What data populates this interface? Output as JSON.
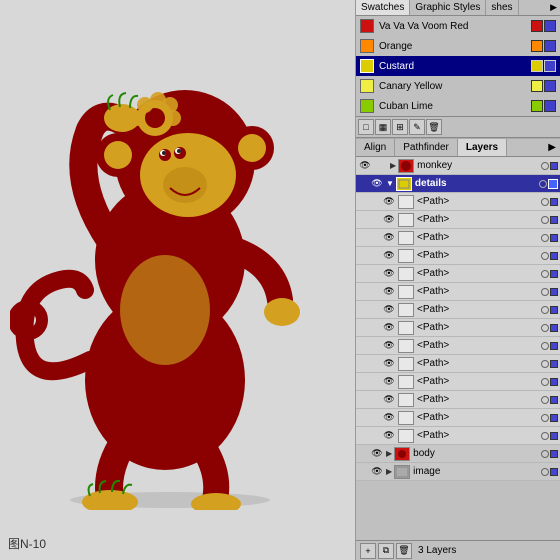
{
  "canvas": {
    "label": "图N-10",
    "background": "#d8d8d8"
  },
  "swatches": {
    "tabs": [
      {
        "id": "swatches",
        "label": "Swatches",
        "active": true
      },
      {
        "id": "graphic-styles",
        "label": "Graphic Styles",
        "active": false
      },
      {
        "id": "shes",
        "label": "shes",
        "active": false
      }
    ],
    "items": [
      {
        "name": "Va Va Va Voom Red",
        "color": "#cc1111",
        "selected": false
      },
      {
        "name": "Orange",
        "color": "#ff8800",
        "selected": false
      },
      {
        "name": "Custard",
        "color": "#ddcc00",
        "selected": true
      },
      {
        "name": "Canary Yellow",
        "color": "#eeee44",
        "selected": false
      },
      {
        "name": "Cuban Lime",
        "color": "#88cc00",
        "selected": false
      }
    ]
  },
  "panels": {
    "align_label": "Align",
    "pathfinder_label": "Pathfinder",
    "layers_label": "Layers",
    "active_tab": "Layers"
  },
  "layers": {
    "items": [
      {
        "id": "monkey",
        "name": "monkey",
        "type": "layer",
        "level": 0,
        "expanded": true,
        "thumb_color": "#cc1111"
      },
      {
        "id": "details",
        "name": "details",
        "type": "sublayer",
        "level": 1,
        "expanded": true,
        "active": true,
        "thumb_color": "#ddcc00"
      },
      {
        "id": "path1",
        "name": "<Path>",
        "type": "path",
        "level": 2
      },
      {
        "id": "path2",
        "name": "<Path>",
        "type": "path",
        "level": 2
      },
      {
        "id": "path3",
        "name": "<Path>",
        "type": "path",
        "level": 2
      },
      {
        "id": "path4",
        "name": "<Path>",
        "type": "path",
        "level": 2
      },
      {
        "id": "path5",
        "name": "<Path>",
        "type": "path",
        "level": 2
      },
      {
        "id": "path6",
        "name": "<Path>",
        "type": "path",
        "level": 2
      },
      {
        "id": "path7",
        "name": "<Path>",
        "type": "path",
        "level": 2
      },
      {
        "id": "path8",
        "name": "<Path>",
        "type": "path",
        "level": 2
      },
      {
        "id": "path9",
        "name": "<Path>",
        "type": "path",
        "level": 2
      },
      {
        "id": "path10",
        "name": "<Path>",
        "type": "path",
        "level": 2
      },
      {
        "id": "path11",
        "name": "<Path>",
        "type": "path",
        "level": 2
      },
      {
        "id": "path12",
        "name": "<Path>",
        "type": "path",
        "level": 2
      },
      {
        "id": "path13",
        "name": "<Path>",
        "type": "path",
        "level": 2
      },
      {
        "id": "path14",
        "name": "<Path>",
        "type": "path",
        "level": 2
      },
      {
        "id": "body",
        "name": "body",
        "type": "sublayer",
        "level": 1,
        "thumb_color": "#cc1111"
      },
      {
        "id": "image",
        "name": "image",
        "type": "sublayer",
        "level": 1,
        "thumb_color": "#888888"
      }
    ],
    "footer": {
      "count_label": "3 Layers"
    }
  }
}
